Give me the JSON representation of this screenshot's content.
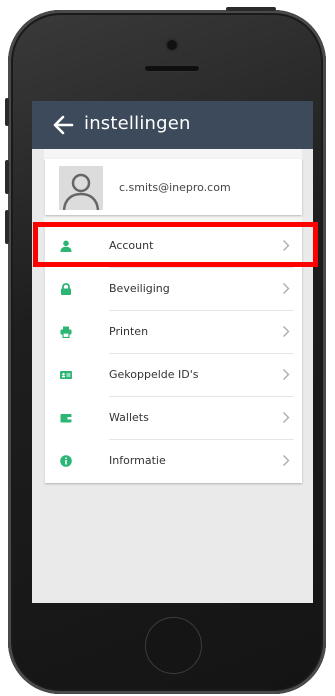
{
  "appbar": {
    "title": "instellingen"
  },
  "profile": {
    "email": "c.smits@inepro.com"
  },
  "menu": {
    "items": [
      {
        "label": "Account",
        "icon": "user-icon"
      },
      {
        "label": "Beveiliging",
        "icon": "lock-icon"
      },
      {
        "label": "Printen",
        "icon": "printer-icon"
      },
      {
        "label": "Gekoppelde ID's",
        "icon": "id-card-icon"
      },
      {
        "label": "Wallets",
        "icon": "wallet-icon"
      },
      {
        "label": "Informatie",
        "icon": "info-icon"
      }
    ]
  },
  "colors": {
    "appbar": "#3d4a5c",
    "accent_icon": "#2bb673",
    "highlight": "#ff0000",
    "screen_bg": "#eaeaea"
  }
}
